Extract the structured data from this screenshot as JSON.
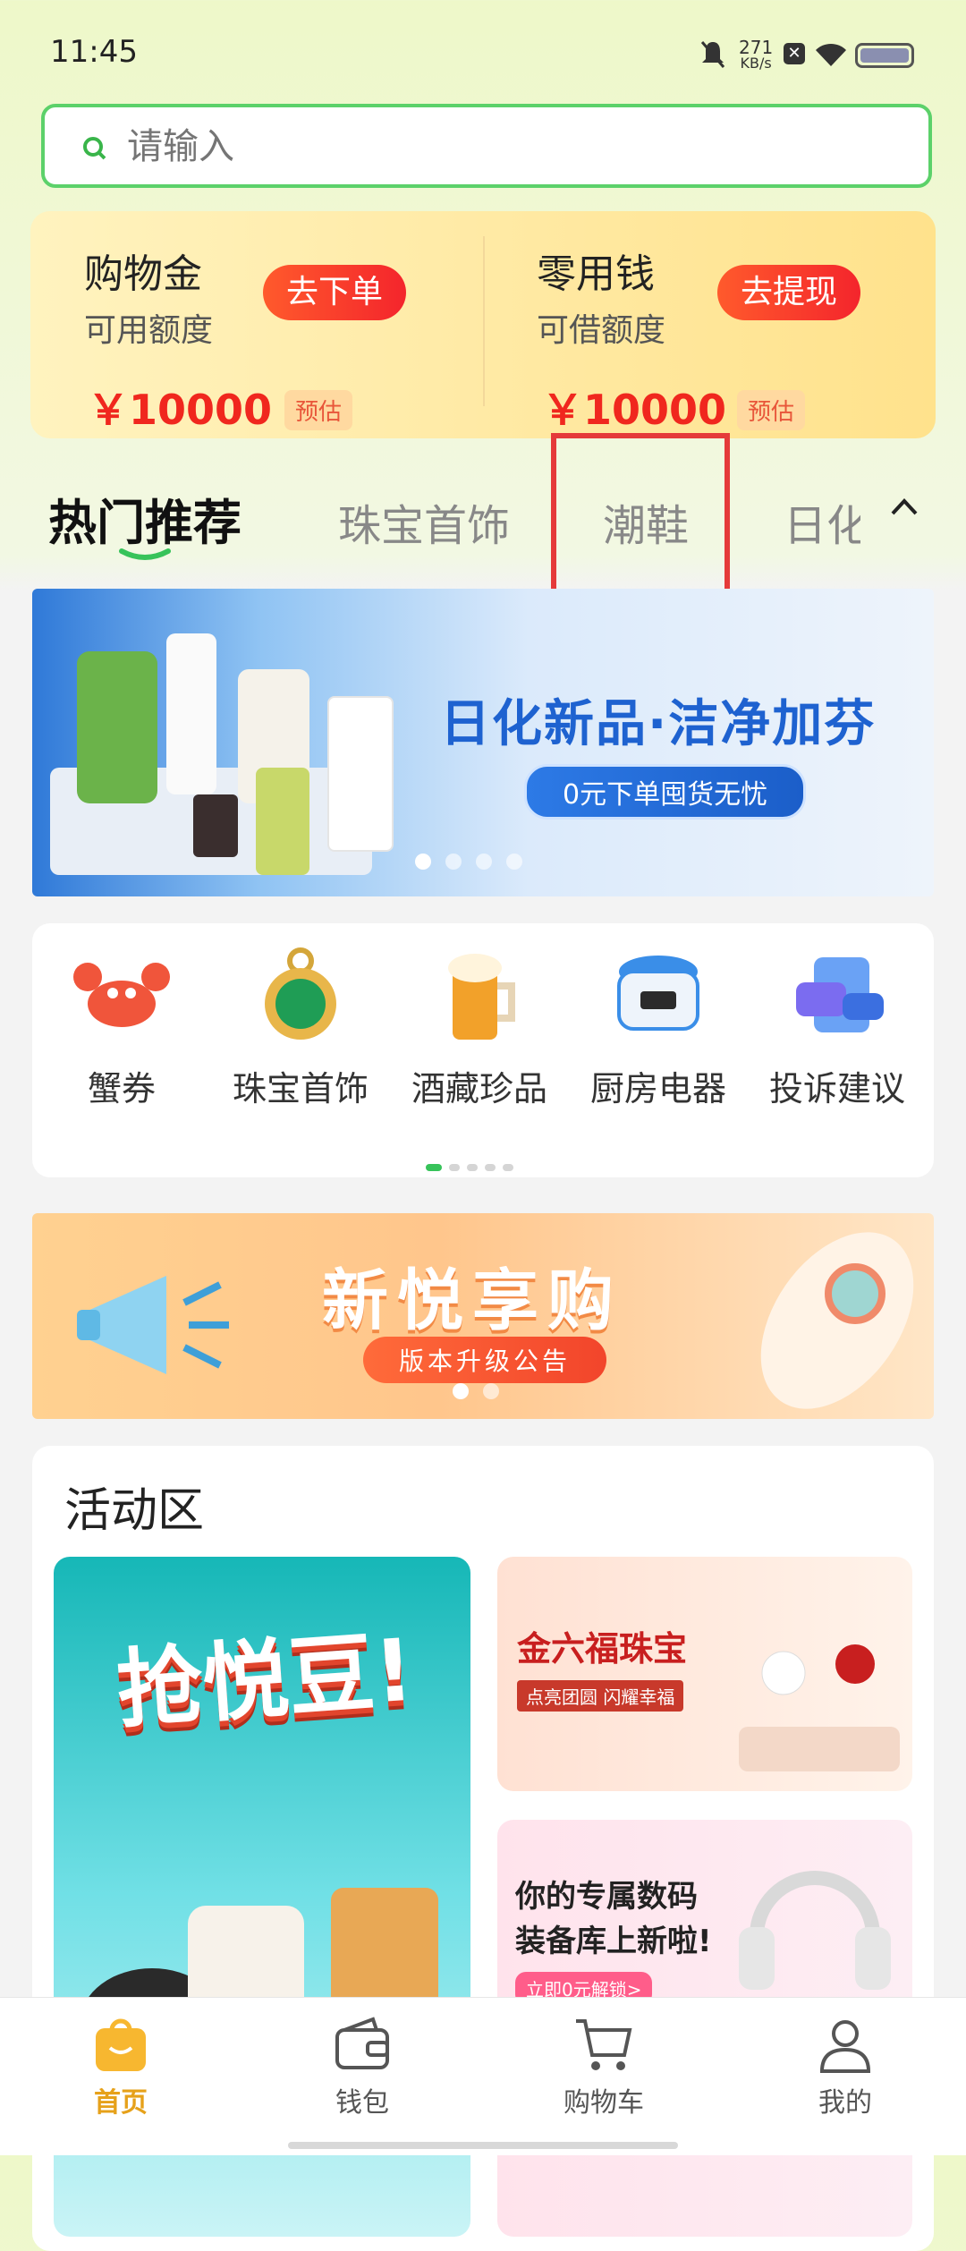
{
  "status_bar": {
    "time": "11:45",
    "net_speed_value": "271",
    "net_speed_unit": "KB/s"
  },
  "search": {
    "placeholder": "请输入"
  },
  "finance": {
    "left": {
      "title": "购物金",
      "subtitle": "可用额度",
      "button": "去下单",
      "amount": "￥10000",
      "tag": "预估"
    },
    "right": {
      "title": "零用钱",
      "subtitle": "可借额度",
      "button": "去提现",
      "amount": "￥10000",
      "tag": "预估"
    }
  },
  "tabs": [
    {
      "label": "热门推荐",
      "active": true
    },
    {
      "label": "珠宝首饰"
    },
    {
      "label": "潮鞋"
    },
    {
      "label": "日化"
    }
  ],
  "banner": {
    "headline": "日化新品·洁净加芬",
    "subline": "0元下单囤货无忧"
  },
  "categories": [
    {
      "label": "蟹券"
    },
    {
      "label": "珠宝首饰"
    },
    {
      "label": "酒藏珍品"
    },
    {
      "label": "厨房电器"
    },
    {
      "label": "投诉建议"
    }
  ],
  "promo": {
    "headline": "新悦享购",
    "subline": "版本升级公告"
  },
  "activity": {
    "title": "活动区",
    "card1": {
      "headline": "抢悦豆!"
    },
    "card2": {
      "headline": "金六福珠宝",
      "subline": "点亮团圆 闪耀幸福"
    },
    "card3": {
      "line1": "你的专属数码",
      "line2": "装备库上新啦!",
      "cta": "立即0元解锁>"
    }
  },
  "nav": [
    {
      "label": "首页",
      "active": true
    },
    {
      "label": "钱包"
    },
    {
      "label": "购物车"
    },
    {
      "label": "我的"
    }
  ],
  "colors": {
    "accent_green": "#5cd16a",
    "nav_active": "#e6a11a",
    "price_red": "#f0271e"
  }
}
